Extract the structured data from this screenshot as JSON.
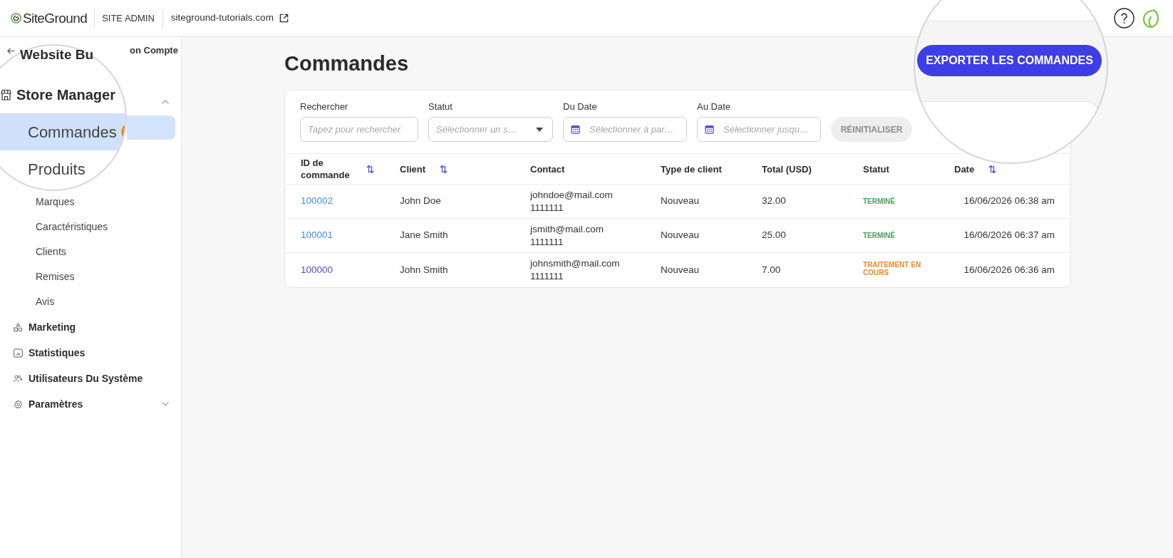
{
  "header": {
    "logo": "SiteGround",
    "section": "SITE ADMIN",
    "site": "siteground-tutorials.com"
  },
  "sidebar": {
    "back_link": "on Compte",
    "store_group": {
      "expanded": true,
      "children": [
        {
          "selected": true
        },
        {
          "label": "Marques",
          "selected": false
        },
        {
          "label": "Caractéristiques",
          "selected": false
        },
        {
          "label": "Clients",
          "selected": false
        },
        {
          "label": "Remises",
          "selected": false
        },
        {
          "label": "Avis",
          "selected": false
        }
      ]
    },
    "items": [
      {
        "label": "Marketing"
      },
      {
        "label": "Statistiques"
      },
      {
        "label": "Utilisateurs Du Système"
      },
      {
        "label": "Paramètres",
        "expanded": false
      }
    ]
  },
  "magnifier_left": {
    "items": [
      {
        "kind": "title",
        "text": "Website Bu"
      },
      {
        "kind": "group",
        "text": "Store Manager"
      },
      {
        "kind": "item",
        "text": "Commandes",
        "selected": true,
        "badge": true
      },
      {
        "kind": "item",
        "text": "Produits",
        "selected": false,
        "badge": false
      }
    ]
  },
  "magnifier_right": {
    "export_button": "EXPORTER LES COMMANDES"
  },
  "page": {
    "title": "Commandes"
  },
  "filters": [
    {
      "kind": "text",
      "label": "Rechercher",
      "placeholder": "Tapez pour rechercher"
    },
    {
      "kind": "select",
      "label": "Statut",
      "placeholder": "Sélectionner un s…"
    },
    {
      "kind": "date",
      "label": "Du Date",
      "placeholder": "Sélectionner à par…"
    },
    {
      "kind": "date",
      "label": "Au Date",
      "placeholder": "Sélectionner jusqu…"
    }
  ],
  "reset_button": {
    "text": "RÉINITIALISER",
    "disabled": true
  },
  "table": {
    "columns": [
      {
        "label": "ID de commande",
        "sortable": true
      },
      {
        "label": "Client",
        "sortable": true
      },
      {
        "label": "Contact",
        "sortable": false
      },
      {
        "label": "Type de client",
        "sortable": false
      },
      {
        "label": "Total (USD)",
        "sortable": false
      },
      {
        "label": "Statut",
        "sortable": false
      },
      {
        "label": "Date",
        "sortable": true
      }
    ],
    "rows": [
      {
        "id": "100002",
        "visited": false,
        "client": "John Doe",
        "email": "johndoe@mail.com",
        "phone": "1111111",
        "customer_type": "Nouveau",
        "total": "32.00",
        "status": {
          "kind": "completed",
          "text": "TERMINÉ"
        },
        "date": "16/06/2026 06:38 am"
      },
      {
        "id": "100001",
        "visited": false,
        "client": "Jane Smith",
        "email": "jsmith@mail.com",
        "phone": "1111111",
        "customer_type": "Nouveau",
        "total": "25.00",
        "status": {
          "kind": "completed",
          "text": "TERMINÉ"
        },
        "date": "16/06/2026 06:37 am"
      },
      {
        "id": "100000",
        "visited": true,
        "client": "John Smith",
        "email": "johnsmith@mail.com",
        "phone": "1111111",
        "customer_type": "Nouveau",
        "total": "7.00",
        "status": {
          "kind": "processing",
          "text": "TRAITEMENT EN COURS"
        },
        "date": "16/06/2026 06:36 am"
      }
    ]
  }
}
